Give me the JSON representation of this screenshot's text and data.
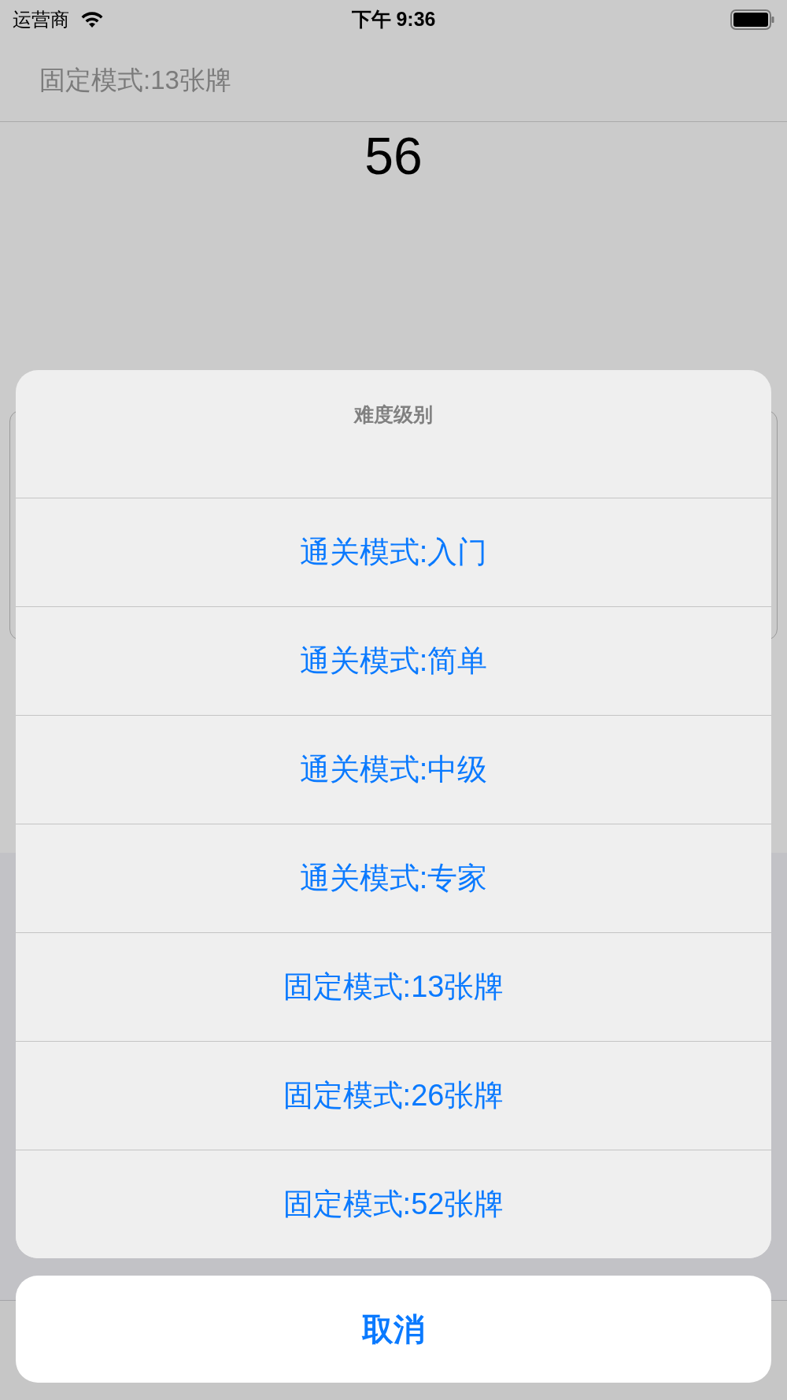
{
  "status_bar": {
    "carrier": "运营商",
    "time": "下午 9:36"
  },
  "nav_bar": {
    "title": "固定模式:13张牌"
  },
  "score": "56",
  "action_sheet": {
    "title": "难度级别",
    "options": [
      {
        "label": "通关模式:入门"
      },
      {
        "label": "通关模式:简单"
      },
      {
        "label": "通关模式:中级"
      },
      {
        "label": "通关模式:专家"
      },
      {
        "label": "固定模式:13张牌"
      },
      {
        "label": "固定模式:26张牌"
      },
      {
        "label": "固定模式:52张牌"
      }
    ],
    "cancel": "取消"
  }
}
